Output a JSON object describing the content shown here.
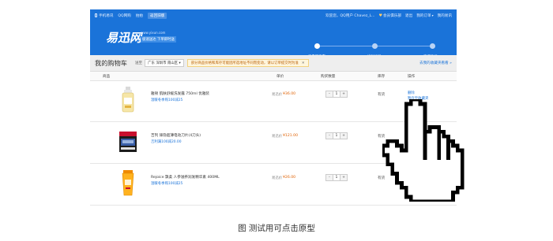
{
  "topbar": {
    "left_items": [
      "手机易讯",
      "QQ网购",
      "拍拍",
      "返回旧版"
    ],
    "greeting": "欢迎您，QQ用户 Chavez_L...",
    "member": "会员俱乐部",
    "logout": "退出",
    "orders": "我的订单",
    "my_yixun": "我的易讯"
  },
  "header": {
    "logo": "易迅网",
    "logo_sub": "www.yixun.com",
    "slogan": "极速送达 下单即时送"
  },
  "steps": [
    {
      "label": "查看购物车",
      "active": true
    },
    {
      "label": "填写订单",
      "active": false
    },
    {
      "label": "完成购买",
      "active": false
    }
  ],
  "cart": {
    "title": "我的购物车",
    "region_label": "送至",
    "region_value": "广东 深圳市 南山区",
    "notice": "部分商品价格和库存可能因所选地址不同而变动，请以订单提交时为准",
    "notice_close": "✕",
    "fav_link": "去我的收藏夹看看 »"
  },
  "columns": {
    "product": "商品",
    "price": "单价",
    "quantity": "购买数量",
    "stock": "库存",
    "ops": "操作"
  },
  "items": [
    {
      "name": "雅顿 肌肤舒缓洗发露 750ml 优雅装",
      "promo": "温暖冬季购100减25",
      "price_label": "易迅价",
      "price": "¥36.00",
      "qty": "1",
      "stock": "有货",
      "op_delete": "删除",
      "op_save": "暂存至收藏夹"
    },
    {
      "name": "吉列 锋隐超薄电动刀片(4刀头)",
      "promo": "吉利满100减20.00",
      "price_label": "易迅价",
      "price": "¥121.00",
      "qty": "1",
      "stock": "有货",
      "op_delete": "删除",
      "op_save": "暂存至收藏夹"
    },
    {
      "name": "Rejoice 飘柔 人参滋养润发精华素 400ML",
      "promo": "温暖冬季购100减25",
      "price_label": "易迅价",
      "price": "¥26.00",
      "qty": "1",
      "stock": "有货",
      "op_delete": "删除",
      "op_save": "暂存至收藏夹"
    }
  ],
  "qty_controls": {
    "minus": "-",
    "plus": "+"
  },
  "caption": "图  测试用可点击原型",
  "colors": {
    "brand_blue": "#1a73d9",
    "price_orange": "#e06000"
  }
}
